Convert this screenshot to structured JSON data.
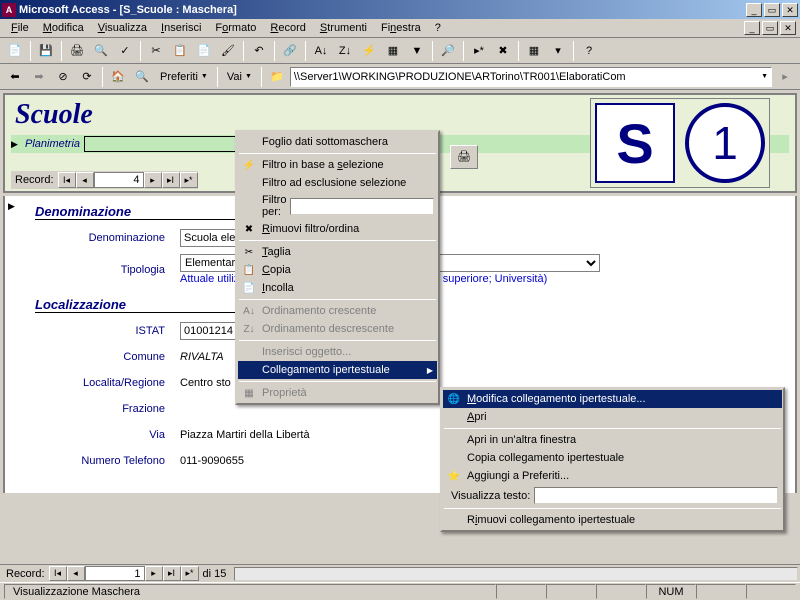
{
  "titlebar": {
    "app": "Microsoft Access",
    "doc": "[S_Scuole : Maschera]"
  },
  "menu": {
    "file": "File",
    "modifica": "Modifica",
    "visualizza": "Visualizza",
    "inserisci": "Inserisci",
    "formato": "Formato",
    "record": "Record",
    "strumenti": "Strumenti",
    "finestra": "Finestra",
    "help": "?"
  },
  "toolbar2": {
    "preferiti": "Preferiti",
    "vai": "Vai",
    "address": "\\\\Server1\\WORKING\\PRODUZIONE\\ARTorino\\TR001\\ElaboratiCom"
  },
  "form": {
    "title": "Scuole",
    "planimetria_label": "Planimetria",
    "record_label": "Record:",
    "record_value": "4",
    "big_s": "S",
    "big_1": "1",
    "grp_denom": "Denominazione",
    "denom_label": "Denominazione",
    "denom_value": "Scuola ele",
    "tipo_label": "Tipologia",
    "tipo_value": "Elementare",
    "tipo_hint": "Attuale utiliz",
    "tipo_hint2": "eriore; Media superiore; Università)",
    "grp_loc": "Localizzazione",
    "istat_label": "ISTAT",
    "istat_value": "01001214",
    "comune_label": "Comune",
    "comune_value": "RIVALTA",
    "locreg_label": "Localita/Regione",
    "locreg_value": "Centro sto",
    "fraz_label": "Frazione",
    "fraz_value": "",
    "via_label": "Via",
    "via_value": "Piazza Martiri della Libertà",
    "tel_label": "Numero Telefono",
    "tel_value": "011-9090655"
  },
  "ctx1": {
    "foglio": "Foglio dati sottomaschera",
    "filtro_sel": "Filtro in base a selezione",
    "filtro_escl": "Filtro ad esclusione selezione",
    "filtro_per": "Filtro per:",
    "rimuovi": "Rimuovi filtro/ordina",
    "taglia": "Taglia",
    "copia": "Copia",
    "incolla": "Incolla",
    "ord_cresc": "Ordinamento crescente",
    "ord_decr": "Ordinamento descrescente",
    "ins_ogg": "Inserisci oggetto...",
    "collegamento": "Collegamento ipertestuale",
    "proprieta": "Proprietà"
  },
  "ctx2": {
    "modifica": "Modifica collegamento ipertestuale...",
    "apri": "Apri",
    "apri_altra": "Apri in un'altra finestra",
    "copia": "Copia collegamento ipertestuale",
    "aggiungi": "Aggiungi a Preferiti...",
    "vis_testo": "Visualizza testo:",
    "rimuovi": "Rimuovi collegamento ipertestuale"
  },
  "bottomnav": {
    "label": "Record:",
    "value": "1",
    "of": "di 15"
  },
  "status": {
    "text": "Visualizzazione Maschera",
    "num": "NUM"
  }
}
